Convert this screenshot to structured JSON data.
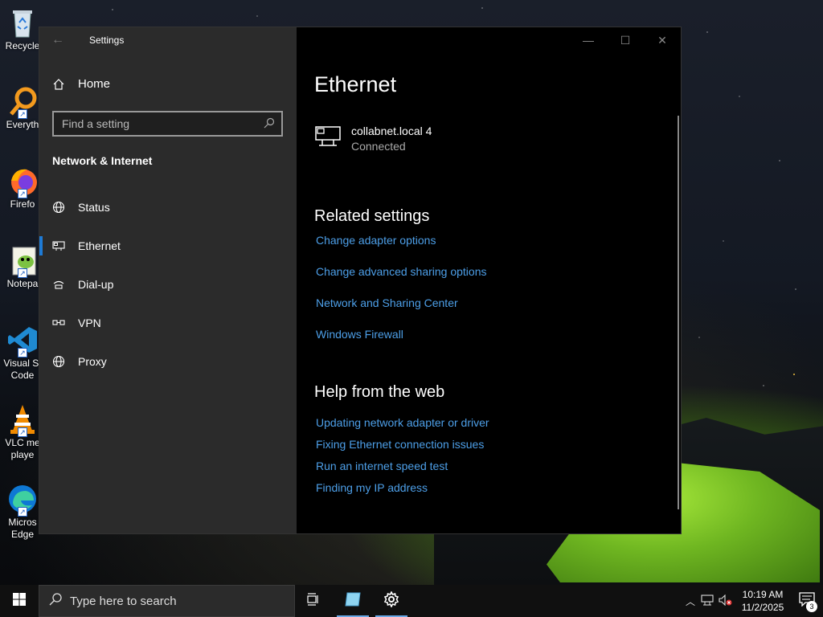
{
  "desktop": {
    "icons": [
      {
        "label": "Recycle",
        "label2": "",
        "icon": "recycle-bin-icon"
      },
      {
        "label": "Everyth",
        "label2": "",
        "icon": "everything-search-icon"
      },
      {
        "label": "Firefo",
        "label2": "",
        "icon": "firefox-icon"
      },
      {
        "label": "Notepa",
        "label2": "",
        "icon": "notepad-plus-plus-icon"
      },
      {
        "label": "Visual St",
        "label2": "Code",
        "icon": "vscode-icon"
      },
      {
        "label": "VLC me",
        "label2": "playe",
        "icon": "vlc-icon"
      },
      {
        "label": "Micros",
        "label2": "Edge",
        "icon": "edge-icon"
      }
    ]
  },
  "window": {
    "title": "Settings",
    "home_label": "Home",
    "search_placeholder": "Find a setting",
    "section_title": "Network & Internet",
    "nav": [
      {
        "label": "Status",
        "icon": "globe-status-icon",
        "active": false
      },
      {
        "label": "Ethernet",
        "icon": "ethernet-icon",
        "active": true
      },
      {
        "label": "Dial-up",
        "icon": "dialup-icon",
        "active": false
      },
      {
        "label": "VPN",
        "icon": "vpn-icon",
        "active": false
      },
      {
        "label": "Proxy",
        "icon": "globe-proxy-icon",
        "active": false
      }
    ],
    "controls": {
      "minimize": "—",
      "maximize": "☐",
      "close": "✕"
    }
  },
  "main": {
    "title": "Ethernet",
    "adapter": {
      "name": "collabnet.local 4",
      "status": "Connected"
    },
    "related_title": "Related settings",
    "related_links": [
      "Change adapter options",
      "Change advanced sharing options",
      "Network and Sharing Center",
      "Windows Firewall"
    ],
    "help_title": "Help from the web",
    "help_links": [
      "Updating network adapter or driver",
      "Fixing Ethernet connection issues",
      "Run an internet speed test",
      "Finding my IP address"
    ]
  },
  "taskbar": {
    "search_placeholder": "Type here to search",
    "time": "10:19 AM",
    "date": "11/2/2025",
    "notification_count": "3"
  },
  "colors": {
    "accent": "#1e7bd6",
    "link": "#4d9fe8",
    "sidebar_bg": "#2b2b2b",
    "main_bg": "#000000"
  }
}
